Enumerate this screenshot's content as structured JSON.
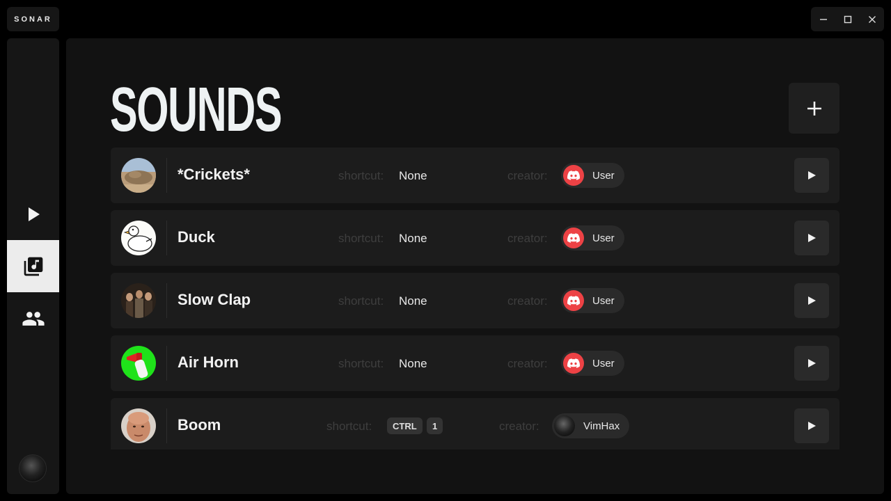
{
  "app": {
    "brand": "SONAR"
  },
  "window_controls": {
    "icons": [
      "minimize-icon",
      "maximize-icon",
      "close-icon"
    ]
  },
  "sidebar": {
    "items": [
      {
        "icon": "play-icon",
        "active": false
      },
      {
        "icon": "music-library-icon",
        "active": true
      },
      {
        "icon": "people-icon",
        "active": false
      }
    ],
    "avatar": "user-avatar"
  },
  "main": {
    "title": "SOUNDS",
    "add_icon": "plus-icon",
    "shortcut_label": "shortcut:",
    "creator_label": "creator:",
    "sounds": [
      {
        "name": "*Crickets*",
        "shortcut": "None",
        "creator": "User",
        "creator_icon": "discord-icon"
      },
      {
        "name": "Duck",
        "shortcut": "None",
        "creator": "User",
        "creator_icon": "discord-icon"
      },
      {
        "name": "Slow Clap",
        "shortcut": "None",
        "creator": "User",
        "creator_icon": "discord-icon"
      },
      {
        "name": "Air Horn",
        "shortcut": "None",
        "creator": "User",
        "creator_icon": "discord-icon"
      },
      {
        "name": "Boom",
        "shortcut_keys": [
          "CTRL",
          "1"
        ],
        "creator": "VimHax",
        "creator_icon": "user-avatar"
      }
    ]
  },
  "colors": {
    "background": "#000000",
    "panel": "#121212",
    "row": "#1c1c1c",
    "discord_red": "#ed4245",
    "active_nav": "#ececec"
  }
}
